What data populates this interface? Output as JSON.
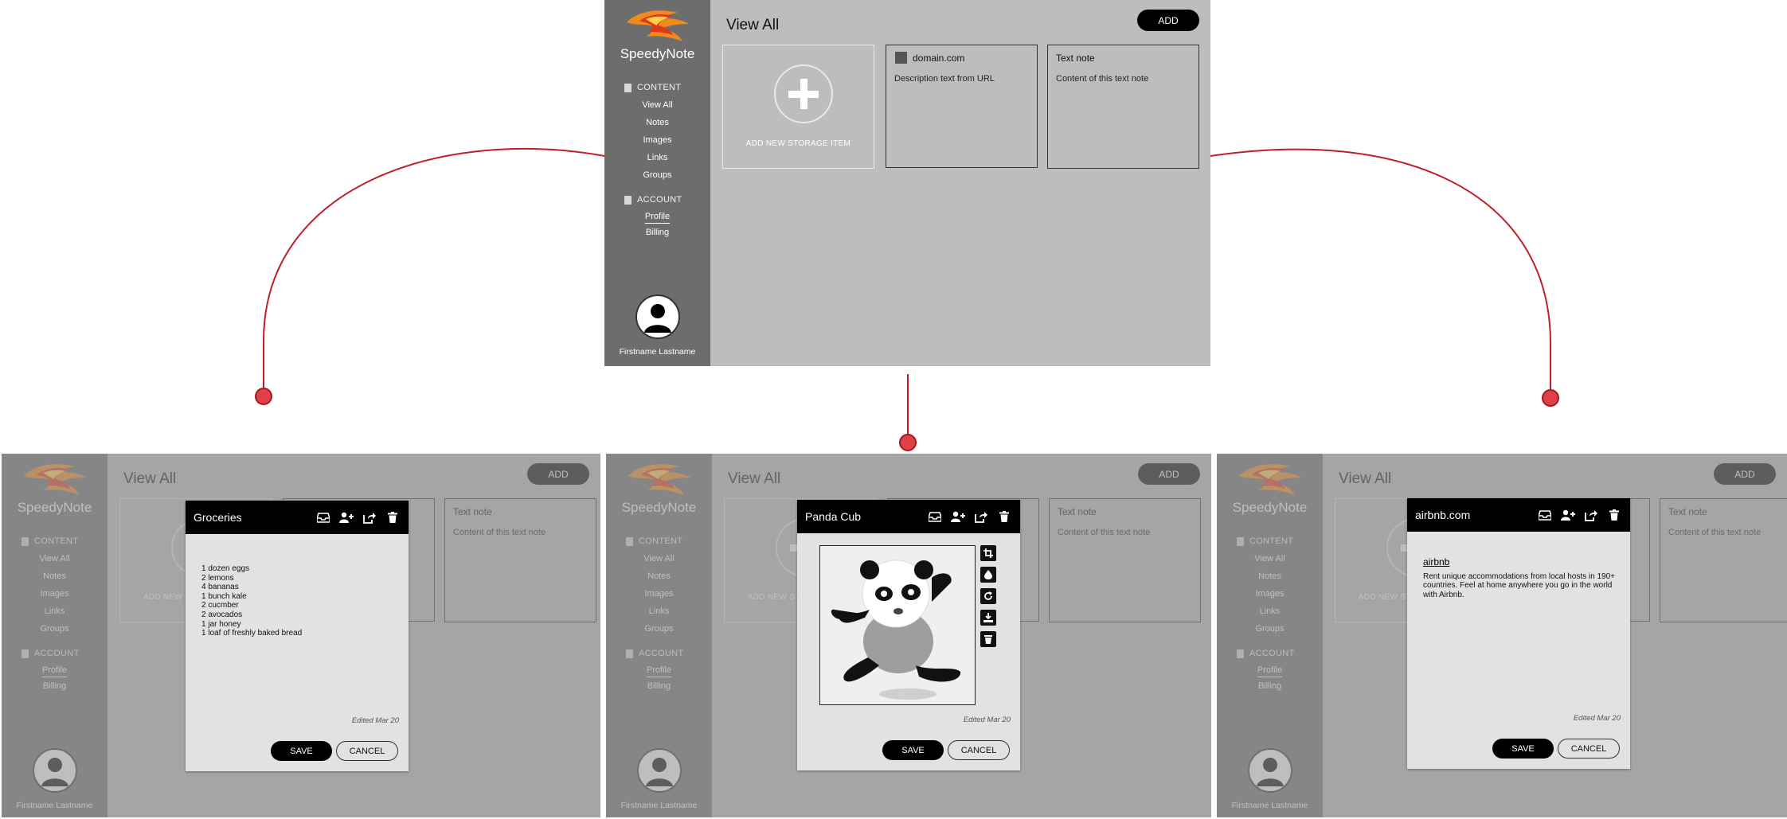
{
  "app": {
    "brand": "SpeedyNote",
    "page_title": "View All",
    "add_label": "ADD",
    "user_name": "Firstname Lastname"
  },
  "sidebar": {
    "content_heading": "CONTENT",
    "content_items": [
      "View All",
      "Notes",
      "Images",
      "Links",
      "Groups"
    ],
    "account_heading": "ACCOUNT",
    "account_items": [
      "Profile",
      "Billing"
    ]
  },
  "cards": {
    "new_item_label": "ADD NEW STORAGE ITEM",
    "link_card": {
      "title": "domain.com",
      "desc": "Description text from URL"
    },
    "text_card": {
      "title": "Text note",
      "desc": "Content of this text note"
    }
  },
  "modals": {
    "note": {
      "title": "Groceries",
      "lines": [
        "1 dozen eggs",
        "2 lemons",
        "4 bananas",
        "1 bunch kale",
        "2 cucmber",
        "2 avocados",
        "1 jar honey",
        "1 loaf of freshly baked bread"
      ],
      "edited": "Edited Mar 20"
    },
    "image": {
      "title": "Panda Cub",
      "edited": "Edited Mar 20"
    },
    "link": {
      "title": "airbnb.com",
      "link_text": "airbnb",
      "desc": "Rent unique accommodations from local hosts in 190+ countries. Feel at home anywhere you go in the world with Airbnb.",
      "edited": "Edited Mar 20"
    },
    "save_label": "SAVE",
    "cancel_label": "CANCEL"
  },
  "icons": {
    "header_icons": [
      "inbox-icon",
      "add-user-icon",
      "share-icon",
      "trash-icon"
    ],
    "image_tools": [
      "crop-icon",
      "drop-icon",
      "rotate-icon",
      "download-icon",
      "trash-icon"
    ]
  },
  "colors": {
    "sidebar": "#6e6d6e",
    "content_bg": "#bdbdbd",
    "connector": "#c0202a",
    "dot": "#e04048",
    "modal_header": "#000000",
    "modal_body": "#e3e1e1"
  }
}
